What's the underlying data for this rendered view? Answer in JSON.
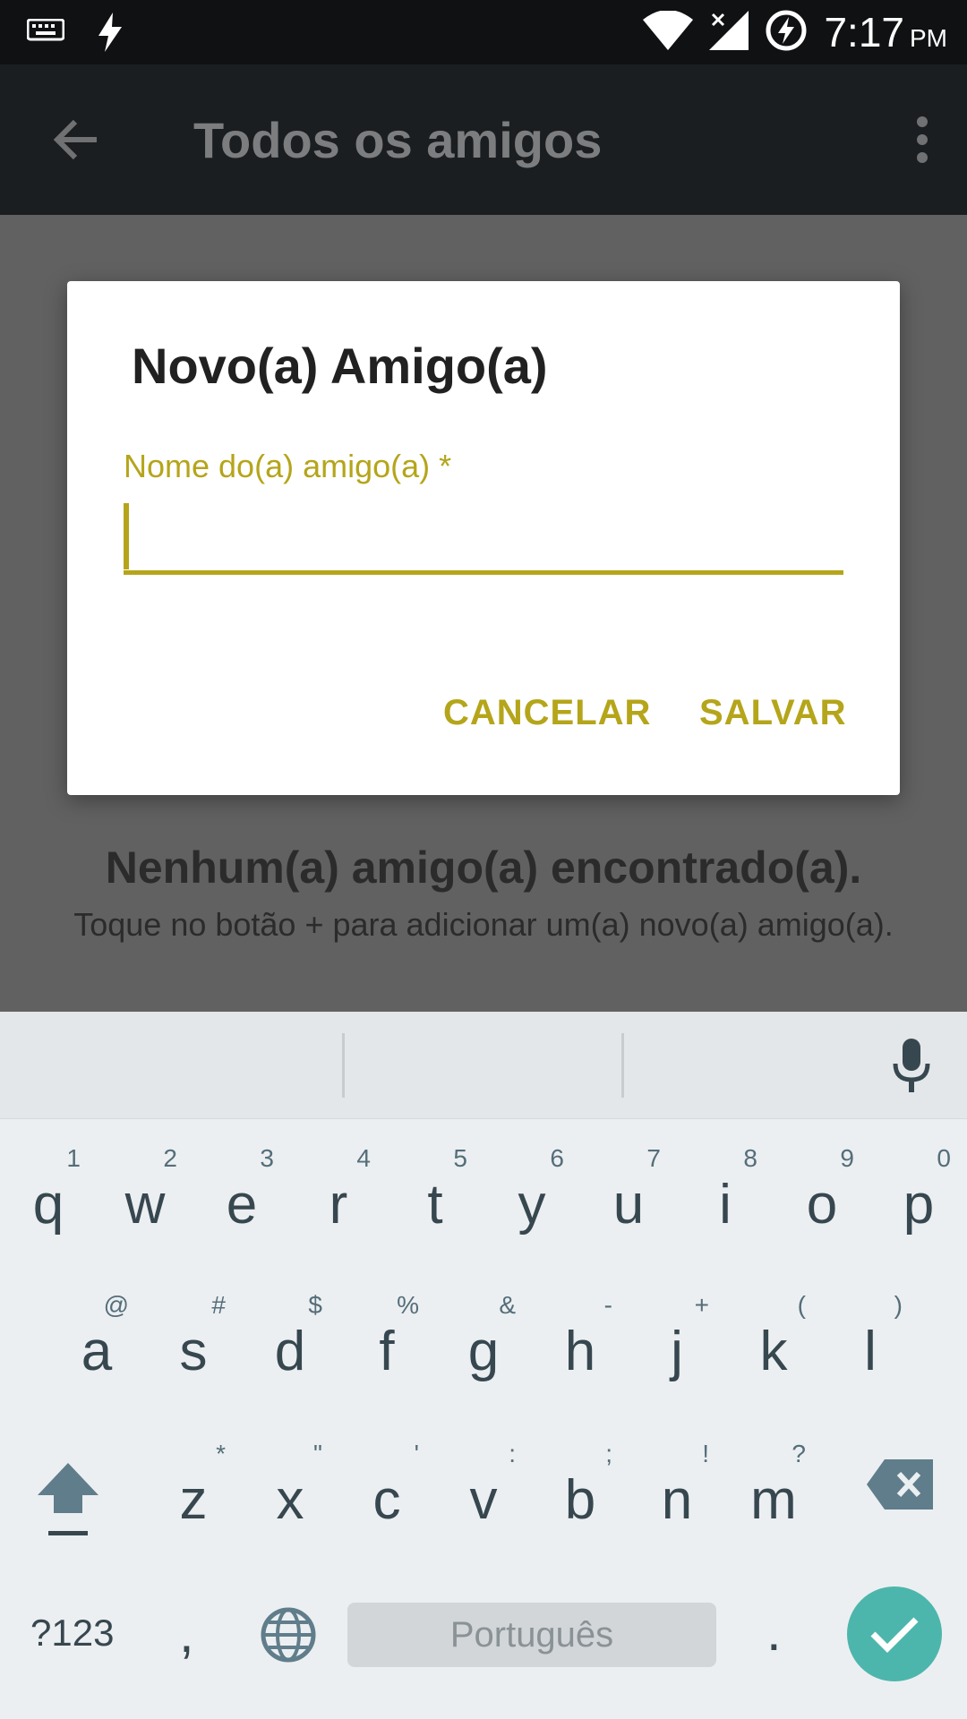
{
  "status_bar": {
    "time": "7:17",
    "ampm": "PM",
    "icons": [
      "keyboard-icon",
      "flash-icon",
      "wifi-icon",
      "signal-off-icon",
      "battery-charging-icon"
    ]
  },
  "app_bar": {
    "title": "Todos os amigos",
    "back_icon": "arrow-left-icon",
    "menu_icon": "more-vert-icon"
  },
  "empty_state": {
    "title": "Nenhum(a) amigo(a) encontrado(a).",
    "subtitle": "Toque no botão + para adicionar um(a) novo(a) amigo(a)."
  },
  "dialog": {
    "title": "Novo(a) Amigo(a)",
    "field_label": "Nome do(a) amigo(a) *",
    "field_value": "",
    "cancel_label": "CANCELAR",
    "save_label": "SALVAR",
    "accent_color": "#b5a51a"
  },
  "keyboard": {
    "row1": [
      {
        "key": "q",
        "hint": "1"
      },
      {
        "key": "w",
        "hint": "2"
      },
      {
        "key": "e",
        "hint": "3"
      },
      {
        "key": "r",
        "hint": "4"
      },
      {
        "key": "t",
        "hint": "5"
      },
      {
        "key": "y",
        "hint": "6"
      },
      {
        "key": "u",
        "hint": "7"
      },
      {
        "key": "i",
        "hint": "8"
      },
      {
        "key": "o",
        "hint": "9"
      },
      {
        "key": "p",
        "hint": "0"
      }
    ],
    "row2": [
      {
        "key": "a",
        "hint": "@"
      },
      {
        "key": "s",
        "hint": "#"
      },
      {
        "key": "d",
        "hint": "$"
      },
      {
        "key": "f",
        "hint": "%"
      },
      {
        "key": "g",
        "hint": "&"
      },
      {
        "key": "h",
        "hint": "-"
      },
      {
        "key": "j",
        "hint": "+"
      },
      {
        "key": "k",
        "hint": "("
      },
      {
        "key": "l",
        "hint": ")"
      }
    ],
    "row3": [
      {
        "key": "z",
        "hint": "*"
      },
      {
        "key": "x",
        "hint": "\""
      },
      {
        "key": "c",
        "hint": "'"
      },
      {
        "key": "v",
        "hint": ":"
      },
      {
        "key": "b",
        "hint": ";"
      },
      {
        "key": "n",
        "hint": "!"
      },
      {
        "key": "m",
        "hint": "?"
      }
    ],
    "symbols_label": "?123",
    "comma": ",",
    "space_label": "Português",
    "period": ".",
    "done_color": "#4db6ac"
  }
}
